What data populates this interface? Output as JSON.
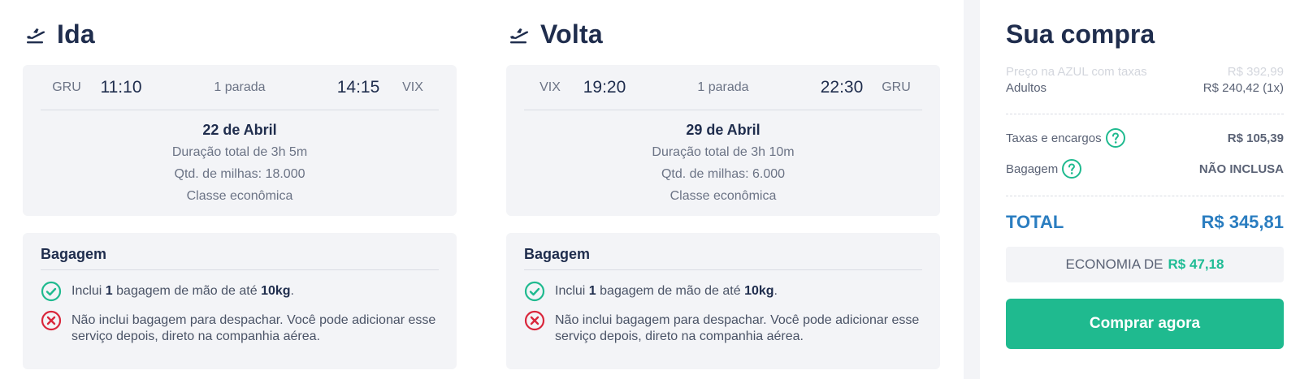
{
  "outbound": {
    "title": "Ida",
    "origin": "GRU",
    "departure_time": "11:10",
    "stops": "1 parada",
    "arrival_time": "14:15",
    "destination": "VIX",
    "date": "22 de Abril",
    "duration": "Duração total de 3h 5m",
    "miles": "Qtd. de milhas: 18.000",
    "cabin": "Classe econômica",
    "baggage": {
      "title": "Bagagem",
      "carry_on_prefix": "Inclui ",
      "carry_on_count": "1",
      "carry_on_middle": " bagagem de mão de até ",
      "carry_on_weight": "10kg",
      "carry_on_suffix": ".",
      "checked": "Não inclui bagagem para despachar. Você pode adicionar esse serviço depois, direto na companhia aérea."
    }
  },
  "return": {
    "title": "Volta",
    "origin": "VIX",
    "departure_time": "19:20",
    "stops": "1 parada",
    "arrival_time": "22:30",
    "destination": "GRU",
    "date": "29 de Abril",
    "duration": "Duração total de 3h 10m",
    "miles": "Qtd. de milhas: 6.000",
    "cabin": "Classe econômica",
    "baggage": {
      "title": "Bagagem",
      "carry_on_prefix": "Inclui ",
      "carry_on_count": "1",
      "carry_on_middle": " bagagem de mão de até ",
      "carry_on_weight": "10kg",
      "carry_on_suffix": ".",
      "checked": "Não inclui bagagem para despachar. Você pode adicionar esse serviço depois, direto na companhia aérea."
    }
  },
  "summary": {
    "title": "Sua compra",
    "airline_price_label": "Preço na AZUL com taxas",
    "airline_price_value": "R$ 392,99",
    "adults_label": "Adultos",
    "adults_value": "R$ 240,42 (1x)",
    "taxes_label": "Taxas e encargos",
    "taxes_value": "R$ 105,39",
    "baggage_label": "Bagagem",
    "baggage_value": "NÃO INCLUSA",
    "total_label": "TOTAL",
    "total_value": "R$ 345,81",
    "economy_label": "ECONOMIA DE",
    "economy_value": "R$ 47,18",
    "buy_button": "Comprar agora"
  },
  "colors": {
    "accent_green": "#1fba8f",
    "total_blue": "#2a7dc0",
    "error_red": "#d9263b",
    "heading_navy": "#1f2d4d"
  },
  "icons": {
    "leg": "airplane-takeoff-icon",
    "included": "check-circle-icon",
    "not_included": "x-circle-icon",
    "help": "question-circle-icon"
  }
}
